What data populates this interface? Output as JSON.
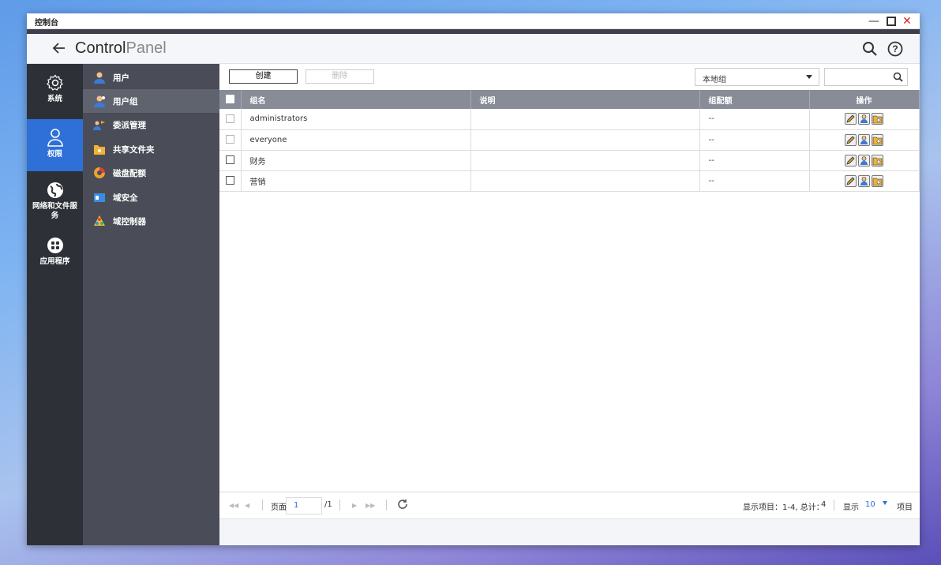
{
  "window": {
    "title": "控制台"
  },
  "header": {
    "brand_control": "Control",
    "brand_panel": "Panel"
  },
  "nav_primary": [
    {
      "label": "系统",
      "icon": "gear-icon"
    },
    {
      "label": "权限",
      "icon": "user-icon",
      "active": true
    },
    {
      "label": "网络和文件服务",
      "icon": "globe-icon"
    },
    {
      "label": "应用程序",
      "icon": "apps-grid-icon"
    }
  ],
  "nav_secondary": [
    {
      "label": "用户",
      "icon": "user-icon"
    },
    {
      "label": "用户组",
      "icon": "user-group-icon",
      "active": true
    },
    {
      "label": "委派管理",
      "icon": "delegate-icon"
    },
    {
      "label": "共享文件夹",
      "icon": "shared-folder-icon"
    },
    {
      "label": "磁盘配额",
      "icon": "disk-quota-icon"
    },
    {
      "label": "域安全",
      "icon": "domain-security-icon"
    },
    {
      "label": "域控制器",
      "icon": "domain-controller-icon"
    }
  ],
  "toolbar": {
    "create_label": "创建",
    "delete_label": "删除",
    "scope_select": "本地组",
    "search_placeholder": ""
  },
  "table": {
    "columns": [
      "组名",
      "说明",
      "组配额",
      "操作"
    ],
    "rows": [
      {
        "name": "administrators",
        "desc": "",
        "quota": "--"
      },
      {
        "name": "everyone",
        "desc": "",
        "quota": "--"
      },
      {
        "name": "财务",
        "desc": "",
        "quota": "--"
      },
      {
        "name": "营销",
        "desc": "",
        "quota": "--"
      }
    ]
  },
  "pager": {
    "page_label": "页面",
    "page_value": "1",
    "total_pages": "/1",
    "display_items_label": "显示项目：",
    "display_range": "1-4, 总计：",
    "total": "4",
    "show_label": "显示",
    "per_page": "10",
    "items_label": "项目"
  },
  "colors": {
    "accent": "#2f6fd8",
    "nav_dark": "#2e3038",
    "nav_mid": "#4a4d57",
    "table_header": "#878c97"
  }
}
